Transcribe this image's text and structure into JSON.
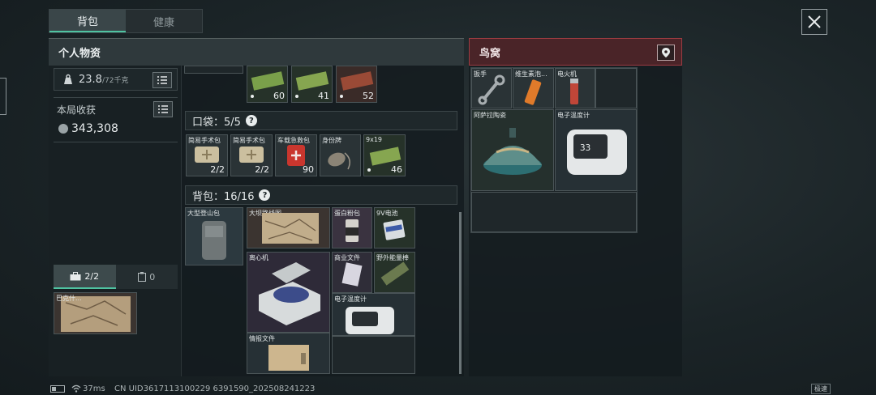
{
  "tabs": [
    {
      "label": "背包",
      "active": true
    },
    {
      "label": "健康",
      "active": false
    }
  ],
  "panel": {
    "title": "个人物资"
  },
  "nest": {
    "title": "鸟窝"
  },
  "weight": {
    "value": "23.8",
    "max": "/72千克"
  },
  "harvest": {
    "label": "本局收获",
    "value": "343,308"
  },
  "mini_tabs": [
    {
      "icon": "toolbox-icon",
      "label": "2/2"
    },
    {
      "icon": "clipboard-icon",
      "label": "0"
    }
  ],
  "safebox_item": {
    "name": "巴克什..."
  },
  "ammo_row": [
    {
      "qty": "60"
    },
    {
      "qty": "41"
    },
    {
      "qty": "52"
    }
  ],
  "pocket": {
    "label": "口袋：5/5",
    "help": "?"
  },
  "pocket_items": [
    {
      "name": "简易手术包",
      "qty": "2/2"
    },
    {
      "name": "简易手术包",
      "qty": "2/2"
    },
    {
      "name": "车载急救包",
      "qty": "90"
    },
    {
      "name": "身份牌",
      "qty": ""
    },
    {
      "name": "9x19",
      "qty": "46"
    }
  ],
  "backpack": {
    "label": "背包：16/16",
    "help": "?"
  },
  "backpack_items": {
    "hiking_bag": "大型登山包",
    "map": "大坝路线图",
    "protein": "蛋白粉包",
    "battery": "9V电池",
    "centrifuge": "离心机",
    "commercial_doc": "商业文件",
    "energy_bar": "野外能量棒",
    "thermometer": "电子温度计",
    "intel_doc": "情报文件"
  },
  "nest_items": {
    "wrench": "扳手",
    "vitamin": "维生素泡...",
    "lighter": "电火机",
    "ceramic": "阿萨拉陶瓷",
    "thermometer": "电子温度计"
  },
  "thermo_display": "33",
  "status_bar": {
    "ping": "37ms",
    "uid": "CN UID3617113100229 6391590_202508241223",
    "badge": "极速"
  },
  "colors": {
    "accent": "#4fc3a1",
    "nest_header": "#4a2428",
    "nest_border": "#9c3b41"
  }
}
